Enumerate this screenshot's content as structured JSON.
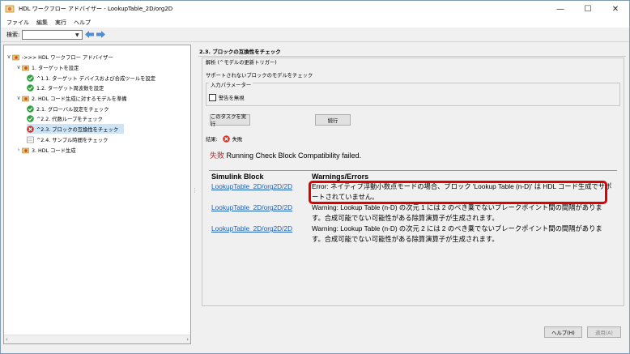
{
  "window": {
    "title": "HDL ワークフロー アドバイザー - LookupTable_2D/org2D",
    "controls": {
      "minimize": "—",
      "maximize": "☐",
      "close": "✕"
    }
  },
  "menu": [
    "ファイル",
    "編集",
    "実行",
    "ヘルプ"
  ],
  "search": {
    "label": "検索:",
    "value": ""
  },
  "tree": [
    {
      "label": "->>> HDL ワークフロー アドバイザー",
      "level": 0,
      "toggle": "∨",
      "icon": "folder-settings-icon"
    },
    {
      "label": "1. ターゲットを設定",
      "level": 1,
      "toggle": "∨",
      "icon": "folder-settings-icon"
    },
    {
      "label": "^1.1. ターゲット デバイスおよび合成ツールを設定",
      "level": 2,
      "toggle": "",
      "icon": "check-pass-icon"
    },
    {
      "label": "1.2. ターゲット周波数を設定",
      "level": 2,
      "toggle": "",
      "icon": "check-pass-icon"
    },
    {
      "label": "2. HDL コード生成に対するモデルを準備",
      "level": 1,
      "toggle": "∨",
      "icon": "folder-settings-icon"
    },
    {
      "label": "2.1. グローバル設定をチェック",
      "level": 2,
      "toggle": "",
      "icon": "check-pass-icon"
    },
    {
      "label": "^2.2. 代数ループをチェック",
      "level": 2,
      "toggle": "",
      "icon": "check-pass-icon"
    },
    {
      "label": "^2.3. ブロックの互換性をチェック",
      "level": 2,
      "toggle": "",
      "icon": "check-fail-icon",
      "selected": true
    },
    {
      "label": "^2.4. サンプル時間をチェック",
      "level": 2,
      "toggle": "",
      "icon": "task-icon"
    },
    {
      "label": "3. HDL コード生成",
      "level": 1,
      "toggle": "›",
      "icon": "folder-settings-icon"
    }
  ],
  "scroll": {
    "left": "‹",
    "right": "›"
  },
  "panel": {
    "title": "2.3. ブロックの互換性をチェック",
    "analysis_legend": "解析 (^モデルの更新トリガー)",
    "description": "サポートされないブロックのモデルをチェック",
    "params_legend": "入力パラメーター",
    "ignore_warnings": "警告を無視",
    "run_task": "このタスクを実行",
    "continue": "続行",
    "result_label": "結果:",
    "result_value": "失敗",
    "fail_word": "失敗",
    "fail_message": " Running Check Block Compatibility failed."
  },
  "report": {
    "headers": [
      "Simulink Block",
      "Warnings/Errors"
    ],
    "rows": [
      {
        "block": "LookupTable_2D/org2D/2D",
        "message": "Error: ネイティブ浮動小数点モードの場合、ブロック 'Lookup Table (n-D)' は HDL コード生成でサポートされていません。"
      },
      {
        "block": "LookupTable_2D/org2D/2D",
        "message": "Warning: Lookup Table (n-D) の次元 1 には 2 のべき乗でないブレークポイント間の間隔があります。合成可能でない可能性がある除算演算子が生成されます。"
      },
      {
        "block": "LookupTable_2D/org2D/2D",
        "message": "Warning: Lookup Table (n-D) の次元 2 には 2 のべき乗でないブレークポイント間の間隔があります。合成可能でない可能性がある除算演算子が生成されます。"
      }
    ]
  },
  "footer": {
    "help": "ヘルプ(H)",
    "apply": "適用(A)"
  },
  "colors": {
    "fail_red": "#e02020",
    "link_blue": "#1a5fb4",
    "highlight_red": "#e00000",
    "selection": "#cde4f7"
  }
}
